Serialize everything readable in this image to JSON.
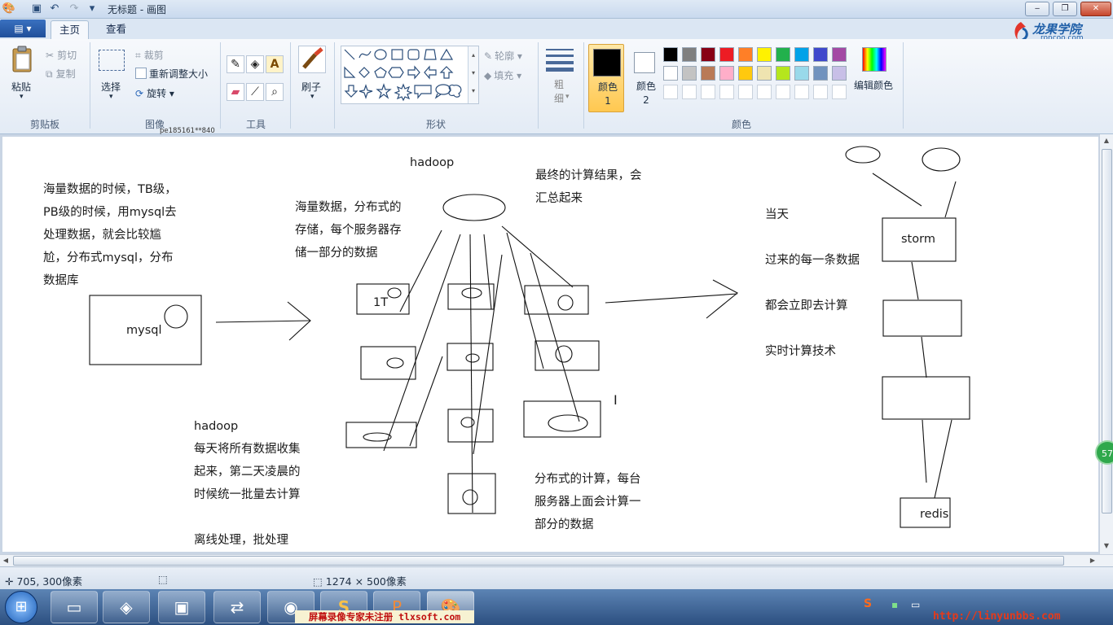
{
  "window": {
    "title": "无标题 - 画图",
    "controls": {
      "minimize": "‒",
      "restore": "❐",
      "close": "✕"
    }
  },
  "tabs": {
    "file": "▤ ▾",
    "home": "主页",
    "view": "查看"
  },
  "logo": {
    "name": "龙果学院",
    "url": "roncoo.com"
  },
  "ribbon": {
    "clipboard": {
      "paste": "粘贴",
      "cut": "剪切",
      "copy": "复制",
      "label": "剪贴板"
    },
    "image": {
      "select": "选择",
      "crop": "裁剪",
      "resize": "重新调整大小",
      "rotate": "旋转",
      "label": "图像",
      "overlay": "pe185161**840"
    },
    "tools": {
      "label": "工具"
    },
    "brush": {
      "label": "刷子"
    },
    "shapes": {
      "outline": "轮廓",
      "fill": "填充",
      "label": "形状"
    },
    "size": {
      "label": "粗细"
    },
    "colors": {
      "color1": "颜色 1",
      "color2": "颜色 2",
      "edit": "编辑颜色",
      "label": "颜色",
      "row1": [
        "#000000",
        "#7f7f7f",
        "#880015",
        "#ed1c24",
        "#ff7f27",
        "#fff200",
        "#22b14c",
        "#00a2e8",
        "#3f48cc",
        "#a349a4"
      ],
      "row2": [
        "#ffffff",
        "#c3c3c3",
        "#b97a57",
        "#ffaec9",
        "#ffc90e",
        "#efe4b0",
        "#b5e61d",
        "#99d9ea",
        "#7092be",
        "#c8bfe7"
      ]
    }
  },
  "canvas": {
    "texts": {
      "mysql_note": [
        "海量数据的时候，TB级，",
        "PB级的时候，用mysql去",
        "处理数据，就会比较尴",
        "尬，分布式mysql，分布",
        "数据库"
      ],
      "mysql_box": "mysql",
      "hadoop_title": "hadoop",
      "storage_note": [
        "海量数据，分布式的",
        "存储，每个服务器存",
        "储一部分的数据"
      ],
      "result_note": [
        "最终的计算结果，会",
        "汇总起来"
      ],
      "one_t": "1T",
      "hadoop_note": [
        "hadoop",
        "每天将所有数据收集",
        "起来，第二天凌晨的",
        "时候统一批量去计算",
        "",
        "离线处理，批处理"
      ],
      "compute_note": [
        "分布式的计算，每台",
        "服务器上面会计算一",
        "部分的数据"
      ],
      "realtime_note": [
        "当天",
        "过来的每一条数据",
        "都会立即去计算",
        "实时计算技术"
      ],
      "storm_box": "storm",
      "redis_box": "redis"
    }
  },
  "status": {
    "cursor": "705, 300像素",
    "size": "1274 × 500像素"
  },
  "taskbar": {
    "watermark": "屏幕录像专家未注册 tlxsoft.com",
    "tray": "http://linyunbbs.com"
  },
  "side_badge": "57"
}
